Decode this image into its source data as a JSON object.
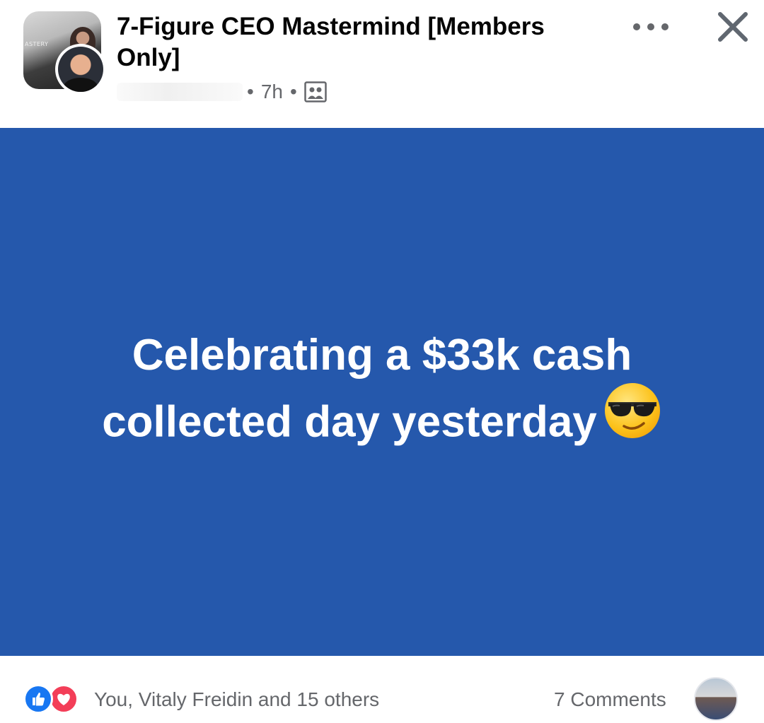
{
  "header": {
    "group_name": "7-Figure CEO Mastermind [Members Only]",
    "group_avatar_text": "ASTERY",
    "time": "7h",
    "separator": "•",
    "audience_icon": "group-audience-icon"
  },
  "post": {
    "text": "Celebrating a $33k cash collected day yesterday",
    "emoji": "smiling-face-with-sunglasses",
    "background_color": "#2558ac"
  },
  "footer": {
    "reactors": "You, Vitaly Freidin and 15 others",
    "comments": "7 Comments",
    "reaction_icons": [
      "like-icon",
      "love-icon"
    ]
  },
  "colors": {
    "accent_like": "#1877f2",
    "accent_love": "#f33e58",
    "secondary_text": "#65676b"
  }
}
